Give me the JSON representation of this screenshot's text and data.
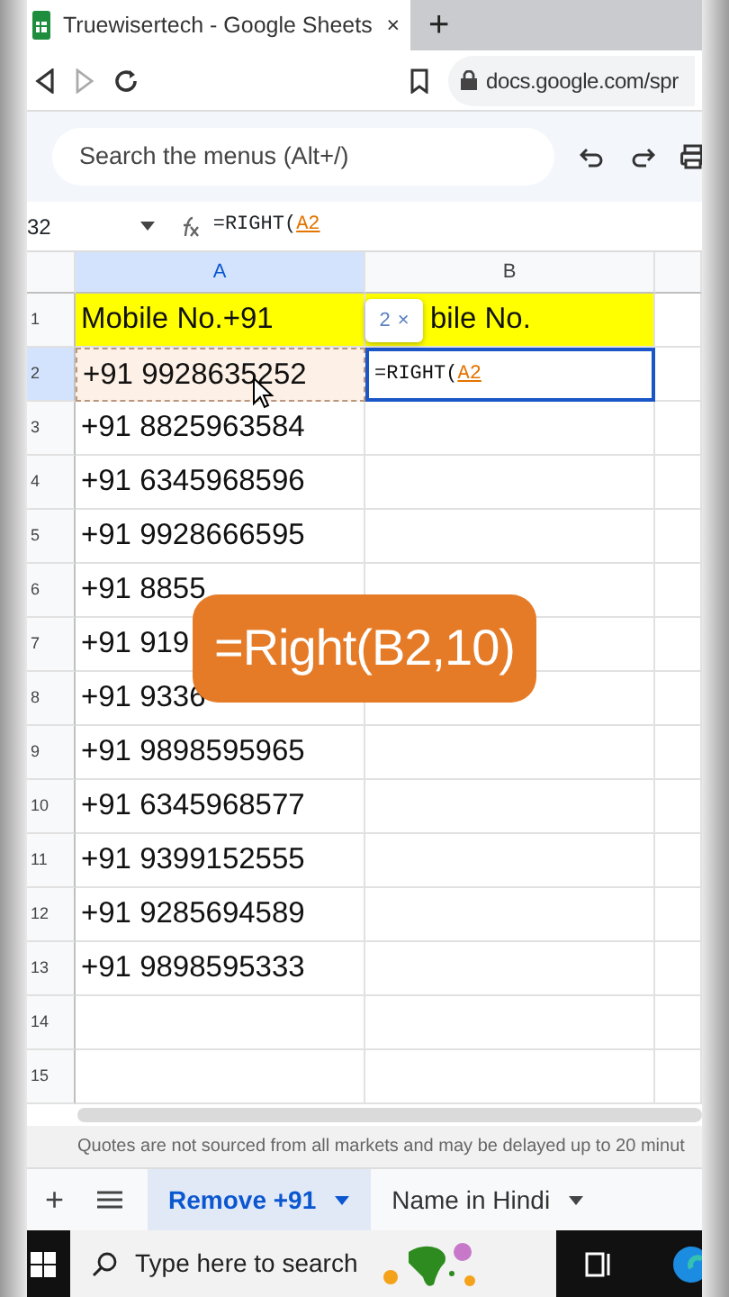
{
  "browser": {
    "tab_title": "Truewisertech - Google Sheets",
    "tab_close": "×",
    "new_tab": "+",
    "url": "docs.google.com/spr"
  },
  "toolbar": {
    "search_placeholder": "Search the menus (Alt+/)"
  },
  "formula_bar": {
    "cell_ref": "32",
    "formula": "=RIGHT(",
    "formula_ref": "A2"
  },
  "columns": [
    {
      "label": "A",
      "selected": true
    },
    {
      "label": "B",
      "selected": false
    }
  ],
  "rows": [
    {
      "number": "1",
      "selected": false,
      "kind": "heading",
      "cells": [
        "Mobile No.+91",
        "bile No."
      ]
    },
    {
      "number": "2",
      "selected": true,
      "kind": "data",
      "cells": [
        "+91 9928635252",
        ""
      ]
    },
    {
      "number": "3",
      "selected": false,
      "kind": "data",
      "cells": [
        "+91 8825963584",
        ""
      ]
    },
    {
      "number": "4",
      "selected": false,
      "kind": "data",
      "cells": [
        "+91 6345968596",
        ""
      ]
    },
    {
      "number": "5",
      "selected": false,
      "kind": "data",
      "cells": [
        "+91 9928666595",
        ""
      ]
    },
    {
      "number": "6",
      "selected": false,
      "kind": "data",
      "cells": [
        "+91 8855",
        ""
      ]
    },
    {
      "number": "7",
      "selected": false,
      "kind": "data",
      "cells": [
        "+91 919",
        ""
      ]
    },
    {
      "number": "8",
      "selected": false,
      "kind": "data",
      "cells": [
        "+91 9336",
        ""
      ]
    },
    {
      "number": "9",
      "selected": false,
      "kind": "data",
      "cells": [
        "+91 9898595965",
        ""
      ]
    },
    {
      "number": "10",
      "selected": false,
      "kind": "data",
      "cells": [
        "+91 6345968577",
        ""
      ]
    },
    {
      "number": "11",
      "selected": false,
      "kind": "data",
      "cells": [
        "+91 9399152555",
        ""
      ]
    },
    {
      "number": "12",
      "selected": false,
      "kind": "data",
      "cells": [
        "+91 9285694589",
        ""
      ]
    },
    {
      "number": "13",
      "selected": false,
      "kind": "data",
      "cells": [
        "+91 9898595333",
        ""
      ]
    },
    {
      "number": "14",
      "selected": false,
      "kind": "data",
      "cells": [
        "",
        ""
      ]
    },
    {
      "number": "15",
      "selected": false,
      "kind": "data",
      "cells": [
        "",
        ""
      ]
    }
  ],
  "editor": {
    "formula": "=RIGHT(",
    "ref": "A2"
  },
  "ref_tooltip": {
    "text": "2",
    "close": "×"
  },
  "overlay": {
    "text": "=Right(B2,10)"
  },
  "notice": "Quotes are not sourced from all markets and may be delayed up to 20 minut",
  "sheet_tabs": {
    "add": "+",
    "items": [
      {
        "label": "Remove +91",
        "selected": true
      },
      {
        "label": "Name in Hindi",
        "selected": false
      }
    ]
  },
  "taskbar": {
    "search_placeholder": "Type here to search"
  }
}
